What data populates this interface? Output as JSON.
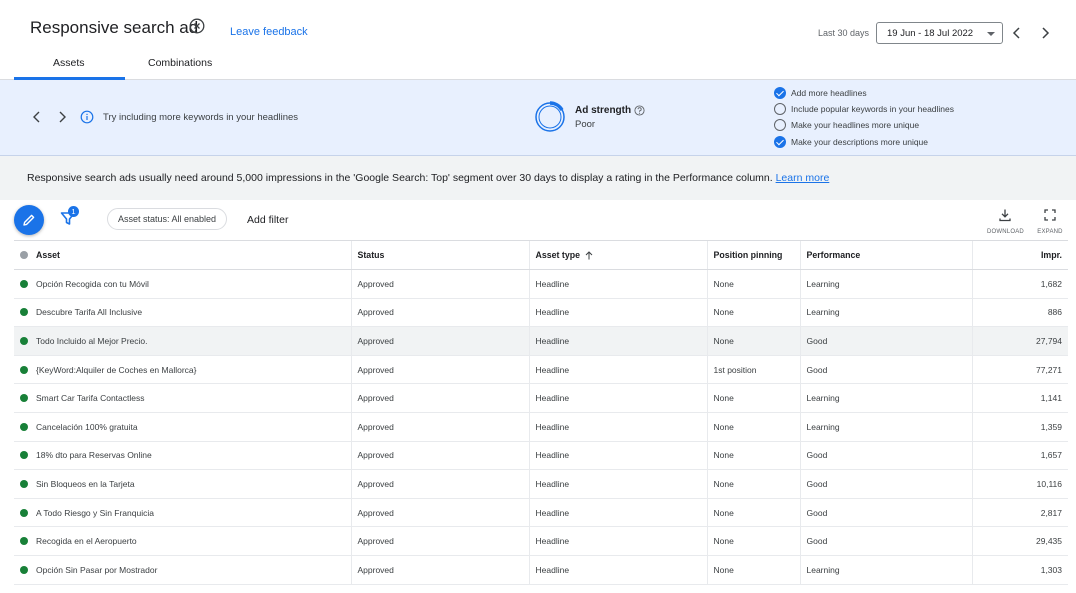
{
  "header": {
    "title": "Responsive search ad",
    "feedback_link": "Leave feedback",
    "range_label": "Last 30 days",
    "date_range": "19 Jun - 18 Jul 2022",
    "tabs": [
      {
        "label": "Assets",
        "active": true
      },
      {
        "label": "Combinations",
        "active": false
      }
    ]
  },
  "banner": {
    "tip": "Try including more keywords in your headlines",
    "ad_strength_label": "Ad strength",
    "ad_strength_value": "Poor",
    "checklist": [
      {
        "label": "Add more headlines",
        "done": true
      },
      {
        "label": "Include popular keywords in your headlines",
        "done": false
      },
      {
        "label": "Make your headlines more unique",
        "done": false
      },
      {
        "label": "Make your descriptions more unique",
        "done": true
      }
    ]
  },
  "notice": {
    "text": "Responsive search ads usually need around 5,000 impressions in the 'Google Search: Top' segment over 30 days to display a rating in the Performance column.",
    "link": "Learn more"
  },
  "toolbar": {
    "filter_count": "1",
    "status_chip": "Asset status: All enabled",
    "add_filter": "Add filter",
    "download_label": "DOWNLOAD",
    "expand_label": "EXPAND"
  },
  "table": {
    "columns": [
      "Asset",
      "Status",
      "Asset type",
      "Position pinning",
      "Performance",
      "Impr."
    ],
    "rows": [
      {
        "asset": "Opción Recogida con tu Móvil",
        "status": "Approved",
        "type": "Headline",
        "pinning": "None",
        "performance": "Learning",
        "impr": "1,682"
      },
      {
        "asset": "Descubre Tarifa All Inclusive",
        "status": "Approved",
        "type": "Headline",
        "pinning": "None",
        "performance": "Learning",
        "impr": "886"
      },
      {
        "asset": "Todo Incluido al Mejor Precio.",
        "status": "Approved",
        "type": "Headline",
        "pinning": "None",
        "performance": "Good",
        "impr": "27,794"
      },
      {
        "asset": "{KeyWord:Alquiler de Coches en Mallorca}",
        "status": "Approved",
        "type": "Headline",
        "pinning": "1st position",
        "performance": "Good",
        "impr": "77,271"
      },
      {
        "asset": "Smart Car Tarifa Contactless",
        "status": "Approved",
        "type": "Headline",
        "pinning": "None",
        "performance": "Learning",
        "impr": "1,141"
      },
      {
        "asset": "Cancelación 100% gratuita",
        "status": "Approved",
        "type": "Headline",
        "pinning": "None",
        "performance": "Learning",
        "impr": "1,359"
      },
      {
        "asset": "18% dto para Reservas Online",
        "status": "Approved",
        "type": "Headline",
        "pinning": "None",
        "performance": "Good",
        "impr": "1,657"
      },
      {
        "asset": "Sin Bloqueos en la Tarjeta",
        "status": "Approved",
        "type": "Headline",
        "pinning": "None",
        "performance": "Good",
        "impr": "10,116"
      },
      {
        "asset": "A Todo Riesgo y Sin Franquicia",
        "status": "Approved",
        "type": "Headline",
        "pinning": "None",
        "performance": "Good",
        "impr": "2,817"
      },
      {
        "asset": "Recogida en el Aeropuerto",
        "status": "Approved",
        "type": "Headline",
        "pinning": "None",
        "performance": "Good",
        "impr": "29,435"
      },
      {
        "asset": "Opción Sin Pasar por Mostrador",
        "status": "Approved",
        "type": "Headline",
        "pinning": "None",
        "performance": "Learning",
        "impr": "1,303"
      }
    ]
  },
  "colors": {
    "accent": "#1a73e8",
    "enabled_dot": "#188038",
    "banner_bg": "#e8f0fe"
  }
}
